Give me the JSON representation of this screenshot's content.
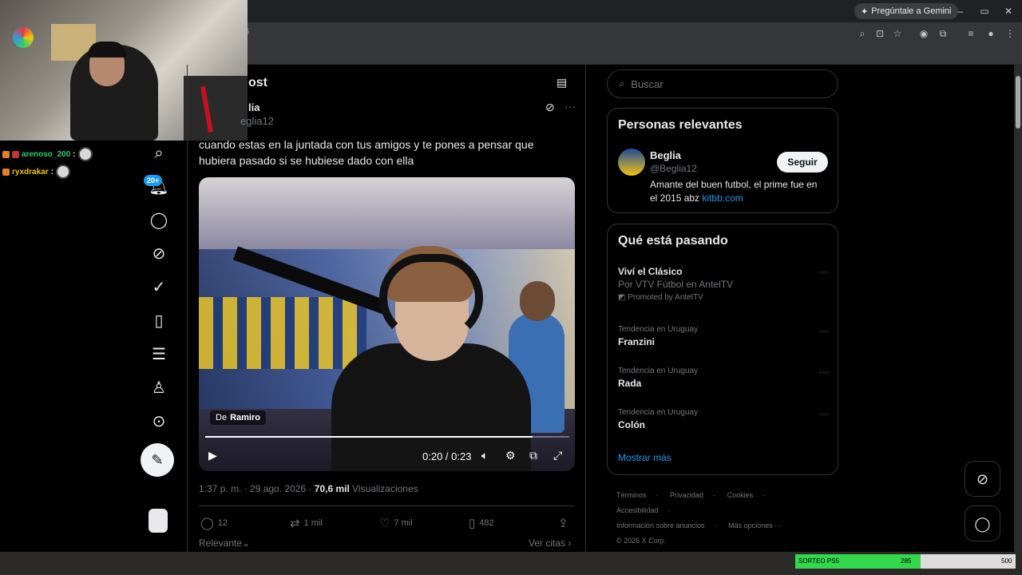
{
  "browser": {
    "gemini_label": "Pregúntale a Gemini",
    "url_fragment": "06",
    "window_controls": [
      "–",
      "▭",
      "✕"
    ]
  },
  "stream_chat": [
    {
      "user": "arenoso_200",
      "color": "#2ecc71"
    },
    {
      "user": "ryxdrakar",
      "color": "#f1c40f"
    }
  ],
  "sidebar": {
    "notification_badge": "20+"
  },
  "post": {
    "header_title": "ost",
    "author_name": "lia",
    "author_handle": "eglia12",
    "text": "cuando estas en la juntada con tus amigos y te pones a pensar que hubiera pasado si se hubiese dado con ella",
    "video": {
      "attribution_prefix": "De",
      "attribution_name": "Ramiro",
      "time": "0:20 / 0:23",
      "progress": 0.9
    },
    "timestamp": "1:37 p. m. · 29 ago. 2026 · ",
    "views_count": "70,6 mil",
    "views_label": " Visualizaciones",
    "replies": "12",
    "reposts": "1 mil",
    "likes": "7 mil",
    "bookmarks": "482",
    "sort_label": "Relevante",
    "quotes_label": "Ver citas"
  },
  "right_column": {
    "search_placeholder": "Buscar",
    "relevant_title": "Personas relevantes",
    "relevant_person": {
      "name": "Beglia",
      "handle": "@Beglia12",
      "follow_label": "Seguir",
      "bio": "Amante del buen futbol, el prime fue en el 2015 abz ",
      "bio_link": "kitbb.com"
    },
    "trends_title": "Qué está pasando",
    "promoted": {
      "name": "Viví el Clásico",
      "sub": "Por VTV Fútbol en AntelTV",
      "promo": "Promoted by AntelTV"
    },
    "trends": [
      {
        "context": "Tendencia en Uruguay",
        "name": "Franzini"
      },
      {
        "context": "Tendencia en Uruguay",
        "name": "Rada"
      },
      {
        "context": "Tendencia en Uruguay",
        "name": "Colón"
      }
    ],
    "show_more": "Mostrar más",
    "footer_links": [
      "Términos",
      "·",
      "Privacidad",
      "·",
      "Cookies",
      "·",
      "Accesibilidad",
      "·"
    ],
    "footer_links_2": [
      "Información sobre anuncios",
      "·",
      "Más opciones ···"
    ],
    "copyright": "© 2026 X Corp."
  },
  "stream_goal": {
    "label": "SORTEO PS5",
    "current": "285",
    "max": "500",
    "fraction": 0.57
  }
}
